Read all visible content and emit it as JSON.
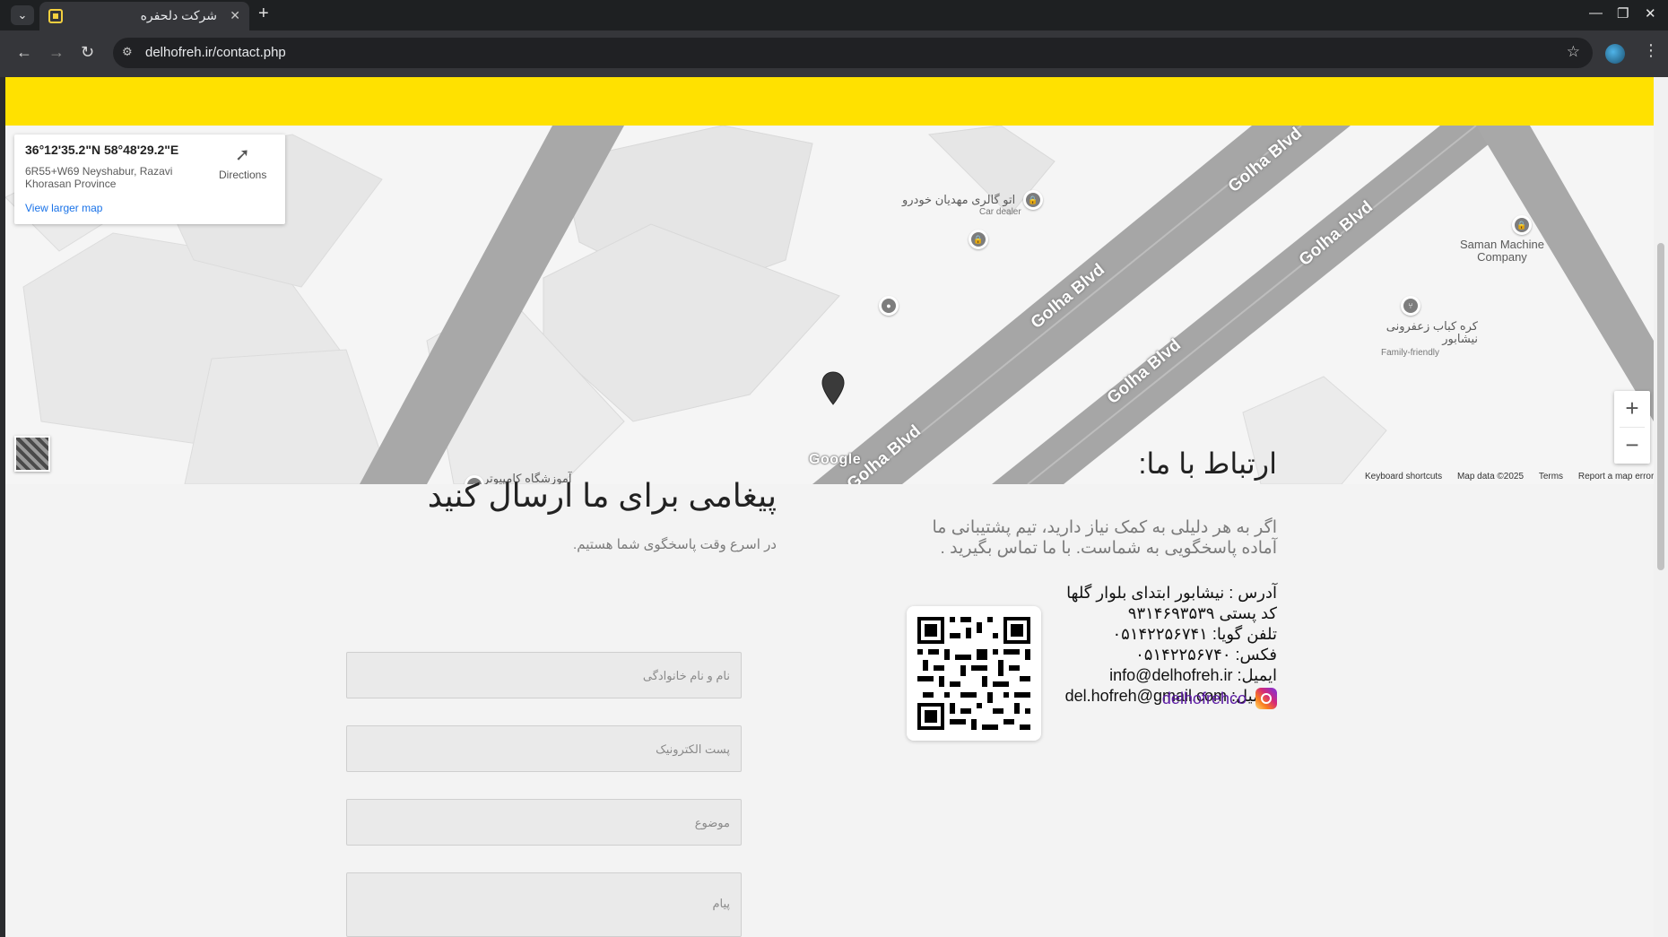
{
  "browser": {
    "tab_title": "شرکت دلحفره",
    "url": "delhofreh.ir/contact.php"
  },
  "icons": {
    "tab_list": "chevron-down-icon",
    "favicon": "site-favicon",
    "close_tab": "close-icon",
    "new_tab": "plus-icon",
    "back": "arrow-left-icon",
    "forward": "arrow-right-icon",
    "reload": "reload-icon",
    "site_info": "tune-icon",
    "bookmark": "star-icon",
    "profile": "profile-avatar",
    "menu": "kebab-menu-icon",
    "directions": "directions-icon",
    "instagram": "instagram-icon"
  },
  "colors": {
    "yellow_bar": "#ffe100",
    "instagram_link": "#5b1aa3"
  },
  "map": {
    "coords": "36°12'35.2\"N 58°48'29.2\"E",
    "address": "6R55+W69 Neyshabur, Razavi Khorasan Province",
    "view_larger_map": "View larger map",
    "directions": "Directions",
    "zoom_in": "+",
    "zoom_out": "−",
    "google": "Google",
    "footer": {
      "keyboard": "Keyboard shortcuts",
      "data": "Map data ©2025",
      "terms": "Terms",
      "report": "Report a map error"
    },
    "roads": [
      "Golha Blvd",
      "Golha Blvd",
      "Golha Blvd",
      "Golha Blvd",
      "Golha Blvd"
    ],
    "pois": {
      "car_dealer_name": "اتو گالری مهدیان خودرو",
      "car_dealer_type": "Car dealer",
      "saman": "Saman Machine Company",
      "kebab_name": "کره کباب زعفرونی نیشابور",
      "kebab_type": "Family-friendly",
      "computer_school": "آموزشگاه کامپیوتر"
    }
  },
  "contact": {
    "title": "ارتباط با ما:",
    "description": "اگر به هر دلیلی به کمک نیاز دارید، تیم پشتیبانی ما آماده پاسخگویی به شماست. با ما تماس بگیرید .",
    "address": "آدرس : نیشابور ابتدای بلوار گلها",
    "postal": "کد پستی ۹۳۱۴۶۹۳۵۳۹",
    "phone": "تلفن گویا: ۰۵۱۴۲۲۵۶۷۴۱",
    "fax": "فکس: ۰۵۱۴۲۲۵۶۷۴۰",
    "email_label": "ایمیل: ",
    "email": "info@delhofreh.ir",
    "gmail_label": "جیمیل: ",
    "gmail": "del.hofreh@gmail.com",
    "instagram": "delhofrehco"
  },
  "form": {
    "title": "پیغامی برای ما ارسال کنید",
    "subtitle": "در اسرع وقت پاسخگوی شما هستیم.",
    "name_placeholder": "نام و نام خانوادگی",
    "email_placeholder": "پست الکترونیک",
    "subject_placeholder": "موضوع",
    "message_placeholder": "پیام"
  }
}
